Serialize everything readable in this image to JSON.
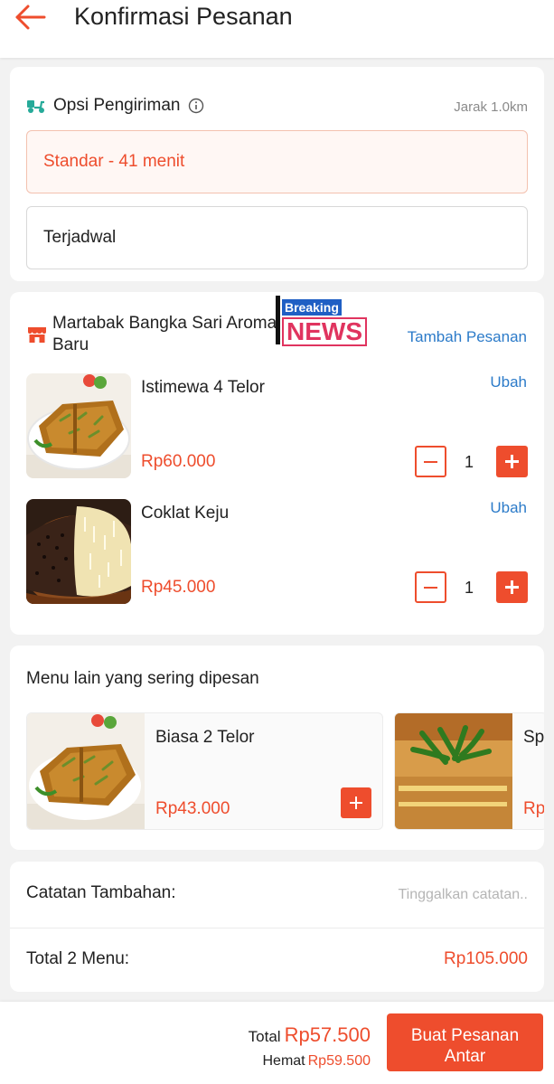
{
  "header": {
    "title": "Konfirmasi Pesanan"
  },
  "shipping": {
    "title": "Opsi Pengiriman",
    "distance": "Jarak 1.0km",
    "options": [
      {
        "label": "Standar - 41 menit",
        "selected": true
      },
      {
        "label": "Terjadwal",
        "selected": false
      }
    ]
  },
  "shop": {
    "name": "Martabak Bangka Sari Aroma Baru",
    "add_order": "Tambah Pesanan",
    "overlay": {
      "top": "Breaking",
      "bottom": "NEWS"
    }
  },
  "cart": {
    "items": [
      {
        "name": "Istimewa 4 Telor",
        "edit": "Ubah",
        "price": "Rp60.000",
        "qty": "1"
      },
      {
        "name": "Coklat Keju",
        "edit": "Ubah",
        "price": "Rp45.000",
        "qty": "1"
      }
    ]
  },
  "recommendations": {
    "title": "Menu lain yang sering dipesan",
    "items": [
      {
        "name": "Biasa 2 Telor",
        "price": "Rp43.000"
      },
      {
        "name": "Sp",
        "price": "Rp"
      }
    ]
  },
  "notes": {
    "label": "Catatan Tambahan:",
    "placeholder": "Tinggalkan catatan.."
  },
  "summary": {
    "label": "Total 2 Menu:",
    "value": "Rp105.000"
  },
  "footer": {
    "total_label": "Total",
    "total_value": "Rp57.500",
    "save_label": "Hemat",
    "save_value": "Rp59.500",
    "button_line1": "Buat Pesanan",
    "button_line2": "Antar"
  },
  "colors": {
    "accent": "#ee4d2d",
    "link": "#2c7bc9",
    "teal": "#26aa99"
  }
}
